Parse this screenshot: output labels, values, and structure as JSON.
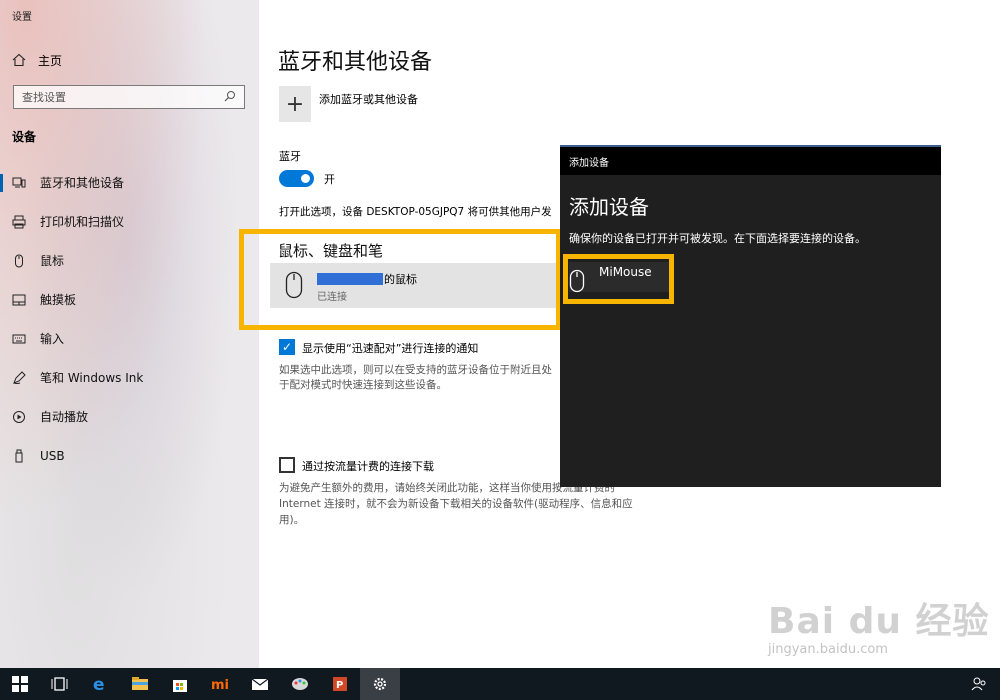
{
  "window": {
    "app_title": "设置"
  },
  "sidebar": {
    "home": {
      "label": "主页",
      "icon": "home-icon"
    },
    "search": {
      "placeholder": "查找设置",
      "icon": "search-icon"
    },
    "section_label": "设备",
    "items": [
      {
        "label": "蓝牙和其他设备",
        "icon": "bluetooth-devices-icon",
        "active": true
      },
      {
        "label": "打印机和扫描仪",
        "icon": "printer-icon"
      },
      {
        "label": "鼠标",
        "icon": "mouse-icon"
      },
      {
        "label": "触摸板",
        "icon": "touchpad-icon"
      },
      {
        "label": "输入",
        "icon": "keyboard-icon"
      },
      {
        "label": "笔和 Windows Ink",
        "icon": "pen-icon"
      },
      {
        "label": "自动播放",
        "icon": "autoplay-icon"
      },
      {
        "label": "USB",
        "icon": "usb-icon"
      }
    ]
  },
  "main": {
    "title": "蓝牙和其他设备",
    "add_device_label": "添加蓝牙或其他设备",
    "bluetooth_label": "蓝牙",
    "bluetooth_state": "开",
    "discover_text": "打开此选项，设备 DESKTOP-05GJPQ7 将可供其他用户发",
    "mouse_section_title": "鼠标、键盘和笔",
    "device": {
      "name_suffix": "的鼠标",
      "status": "已连接"
    },
    "swift_pair": {
      "label": "显示使用“迅速配对”进行连接的通知",
      "checked": true,
      "description": "如果选中此选项，则可以在受支持的蓝牙设备位于附近且处于配对模式时快速连接到这些设备。"
    },
    "metered": {
      "label": "通过按流量计费的连接下载",
      "checked": false,
      "description": "为避免产生额外的费用，请始终关闭此功能，这样当你使用按流量计费的 Internet 连接时，就不会为新设备下载相关的设备软件(驱动程序、信息和应用)。"
    }
  },
  "dialog": {
    "titlebar": "添加设备",
    "title": "添加设备",
    "subtitle": "确保你的设备已打开并可被发现。在下面选择要连接的设备。",
    "device_name": "MiMouse"
  },
  "watermark": {
    "main": "Bai du 经验",
    "sub": "jingyan.baidu.com"
  },
  "taskbar": {
    "items": [
      "windows-start-icon",
      "task-view-icon",
      "edge-icon",
      "file-explorer-icon",
      "store-icon",
      "mi-icon",
      "mail-icon",
      "paint-icon",
      "powerpoint-icon",
      "settings-icon"
    ]
  },
  "colors": {
    "accent": "#0078d7",
    "highlight": "#f7b500",
    "dialog_bg": "#1f1f1f",
    "taskbar_bg": "#101820"
  }
}
